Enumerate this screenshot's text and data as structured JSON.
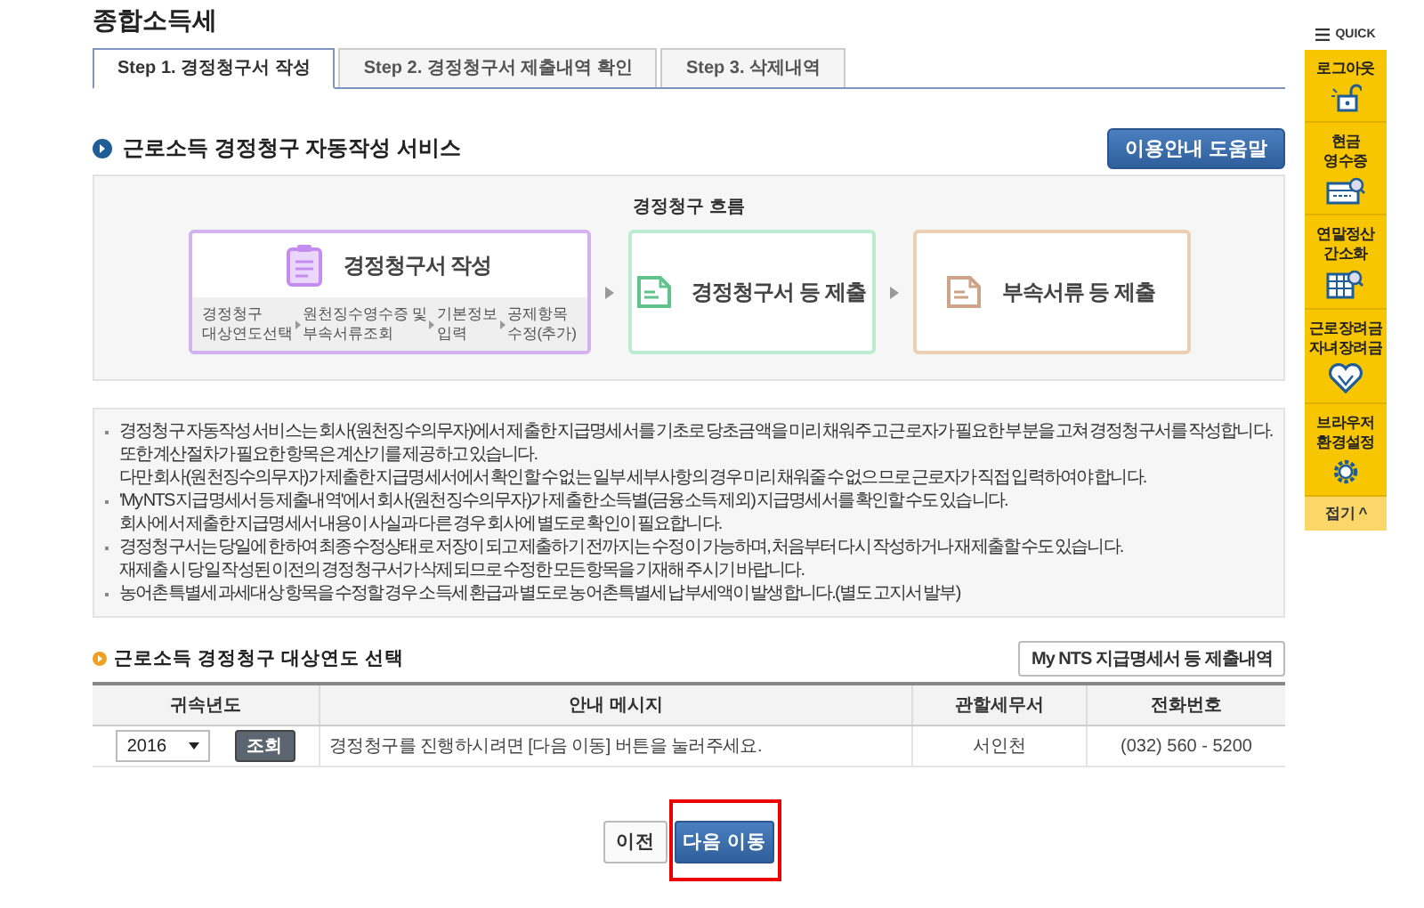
{
  "page_title": "종합소득세",
  "tabs": [
    {
      "label": "Step 1. 경정청구서 작성",
      "selected": true
    },
    {
      "label": "Step 2. 경정청구서 제출내역 확인",
      "selected": false
    },
    {
      "label": "Step 3. 삭제내역",
      "selected": false
    }
  ],
  "section_title": "근로소득 경정청구 자동작성 서비스",
  "help_button": "이용안내 도움말",
  "flow": {
    "title": "경정청구 흐름",
    "steps": [
      {
        "title": "경정청구서 작성",
        "color": "#d2b3f0",
        "substeps": [
          "경정청구\n대상연도선택",
          "원천징수영수증 및\n부속서류조회",
          "기본정보\n입력",
          "공제항목\n수정(추가)"
        ]
      },
      {
        "title": "경정청구서 등 제출",
        "color": "#bdebd2"
      },
      {
        "title": "부속서류 등 제출",
        "color": "#ebcfb5"
      }
    ]
  },
  "notes": [
    [
      "경정청구 자동작성 서비스는 회사(원천징수의무자)에서 제출한 지급명세서를 기초로 당초금액을 미리 채워주고 근로자가 필요한 부분을 고쳐 경정청구서를 작성합니다.",
      "또한 계산절차가 필요한 항목은 계산기를 제공하고 있습니다.",
      "다만 회사(원천징수의무자)가 제출한 지급명세서에서 확인할 수 없는 일부 세부사항의 경우 미리 채워줄 수 없으므로 근로자가 직접 입력하여야 합니다."
    ],
    [
      "'My NTS 지급명세서 등 제출내역'에서 회사(원천징수의무자)가 제출한 소득별(금융소득 제외) 지급명세서를 확인할 수도 있습니다.",
      "회사에서 제출한 지급명세서 내용이 사실과 다른 경우 회사에 별도로 확인이 필요합니다."
    ],
    [
      "경정청구서는 당일에 한하여 최종 수정상태로 저장이 되고 제출하기 전까지는 수정이 가능하며, 처음부터 다시 작성하거나 재제출할 수도 있습니다.",
      "재제출 시 당일 작성된 이전의 경정청구서가 삭제되므로 수정한 모든항목을 기재해 주시기 바랍니다."
    ],
    [
      "농어촌특별세 과세대상 항목을 수정할 경우 소득세 환급과 별도로 농어촌특별세 납부세액이 발생합니다.(별도 고지서 발부)"
    ]
  ],
  "year_section": {
    "title": "근로소득 경정청구 대상연도 선택",
    "link_button": "My NTS 지급명세서 등 제출내역"
  },
  "table": {
    "columns": [
      "귀속년도",
      "안내 메시지",
      "관할세무서",
      "전화번호"
    ],
    "rows": [
      {
        "year": "2016",
        "lookup_button": "조회",
        "message": "경정청구를 진행하시려면 [다음 이동] 버튼을 눌러주세요.",
        "office": "서인천",
        "phone": "(032) 560 - 5200"
      }
    ]
  },
  "buttons": [
    {
      "label": "이전",
      "kind": "secondary",
      "highlighted": false
    },
    {
      "label": "다음 이동",
      "kind": "primary",
      "highlighted": true
    }
  ],
  "quick": {
    "title": "QUICK",
    "items": [
      "로그아웃",
      "현금\n영수증",
      "연말정산\n간소화",
      "근로장려금\n자녀장려금",
      "브라우저\n환경설정"
    ],
    "collapse": "접기 ^"
  }
}
